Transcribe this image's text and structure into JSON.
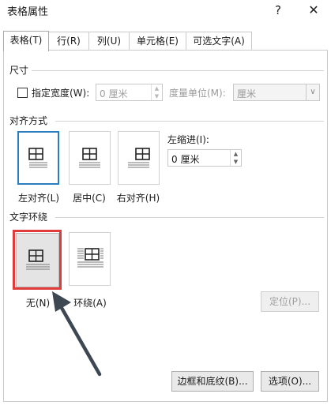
{
  "window": {
    "title": "表格属性",
    "help": "?",
    "close": "✕"
  },
  "tabs": [
    "表格(T)",
    "行(R)",
    "列(U)",
    "单元格(E)",
    "可选文字(A)"
  ],
  "size": {
    "title": "尺寸",
    "width_label": "指定宽度(W):",
    "width_value": "0 厘米",
    "unit_label": "度量单位(M):",
    "unit_value": "厘米"
  },
  "alignment": {
    "title": "对齐方式",
    "options": [
      "左对齐(L)",
      "居中(C)",
      "右对齐(H)"
    ],
    "indent_label": "左缩进(I):",
    "indent_value": "0 厘米"
  },
  "wrapping": {
    "title": "文字环绕",
    "options": [
      "无(N)",
      "环绕(A)"
    ],
    "position_button": "定位(P)..."
  },
  "footer": {
    "borders_button": "边框和底纹(B)...",
    "options_button": "选项(O)..."
  }
}
